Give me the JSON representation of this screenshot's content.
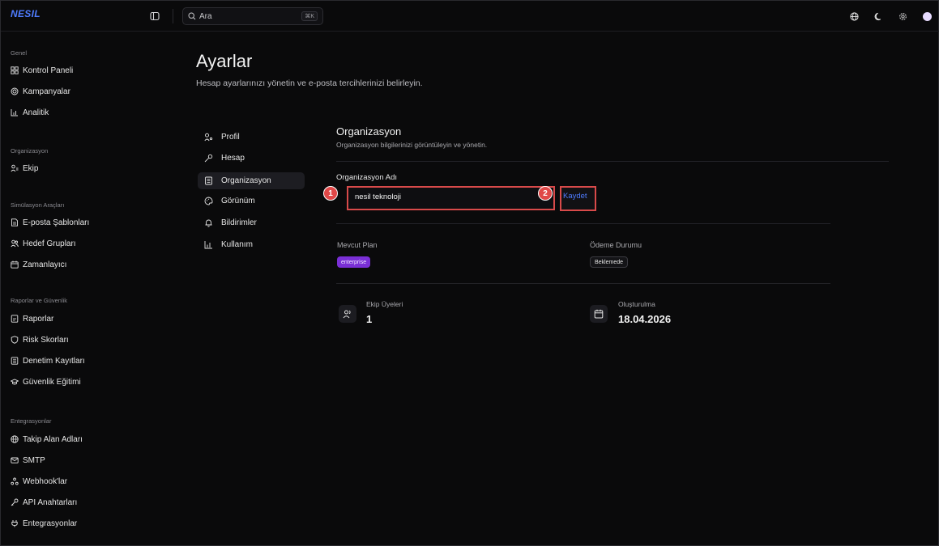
{
  "brand": "NESIL",
  "search": {
    "placeholder": "Ara",
    "shortcut": "⌘K"
  },
  "sidebar": {
    "sections": [
      {
        "title": "Genel",
        "items": [
          {
            "label": "Kontrol Paneli",
            "icon": "dashboard-icon"
          },
          {
            "label": "Kampanyalar",
            "icon": "target-icon"
          },
          {
            "label": "Analitik",
            "icon": "chart-icon"
          }
        ]
      },
      {
        "title": "Organizasyon",
        "items": [
          {
            "label": "Ekip",
            "icon": "users-icon"
          }
        ]
      },
      {
        "title": "Simülasyon Araçları",
        "items": [
          {
            "label": "E-posta Şablonları",
            "icon": "file-icon"
          },
          {
            "label": "Hedef Grupları",
            "icon": "group-icon"
          },
          {
            "label": "Zamanlayıcı",
            "icon": "calendar-icon"
          }
        ]
      },
      {
        "title": "Raporlar ve Güvenlik",
        "items": [
          {
            "label": "Raporlar",
            "icon": "report-icon"
          },
          {
            "label": "Risk Skorları",
            "icon": "shield-icon"
          },
          {
            "label": "Denetim Kayıtları",
            "icon": "audit-icon"
          },
          {
            "label": "Güvenlik Eğitimi",
            "icon": "graduation-icon"
          }
        ]
      },
      {
        "title": "Entegrasyonlar",
        "items": [
          {
            "label": "Takip Alan Adları",
            "icon": "globe-icon"
          },
          {
            "label": "SMTP",
            "icon": "mail-icon"
          },
          {
            "label": "Webhook'lar",
            "icon": "webhook-icon"
          },
          {
            "label": "API Anahtarları",
            "icon": "key-icon"
          },
          {
            "label": "Entegrasyonlar",
            "icon": "plug-icon"
          }
        ]
      }
    ]
  },
  "page": {
    "title": "Ayarlar",
    "subtitle": "Hesap ayarlarınızı yönetin ve e-posta tercihlerinizi belirleyin."
  },
  "settings_nav": [
    {
      "label": "Profil",
      "icon": "user-key-icon",
      "active": false
    },
    {
      "label": "Hesap",
      "icon": "key-icon",
      "active": false
    },
    {
      "label": "Organizasyon",
      "icon": "building-icon",
      "active": true
    },
    {
      "label": "Görünüm",
      "icon": "palette-icon",
      "active": false
    },
    {
      "label": "Bildirimler",
      "icon": "bell-icon",
      "active": false
    },
    {
      "label": "Kullanım",
      "icon": "chart-icon",
      "active": false
    }
  ],
  "organization": {
    "title": "Organizasyon",
    "subtitle": "Organizasyon bilgilerinizi görüntüleyin ve yönetin.",
    "name_label": "Organizasyon Adı",
    "name_value": "nesil teknoloji",
    "save_label": "Kaydet",
    "plan_label": "Mevcut Plan",
    "plan_value": "enterprise",
    "payment_label": "Ödeme Durumu",
    "payment_value": "Beklemede",
    "members_label": "Ekip Üyeleri",
    "members_value": "1",
    "created_label": "Oluşturulma",
    "created_value": "18.04.2026"
  },
  "annotations": [
    "1",
    "2"
  ],
  "colors": {
    "accent": "#4f7cff",
    "plan_badge": "#7a2fd6",
    "annotation": "#e04848"
  }
}
